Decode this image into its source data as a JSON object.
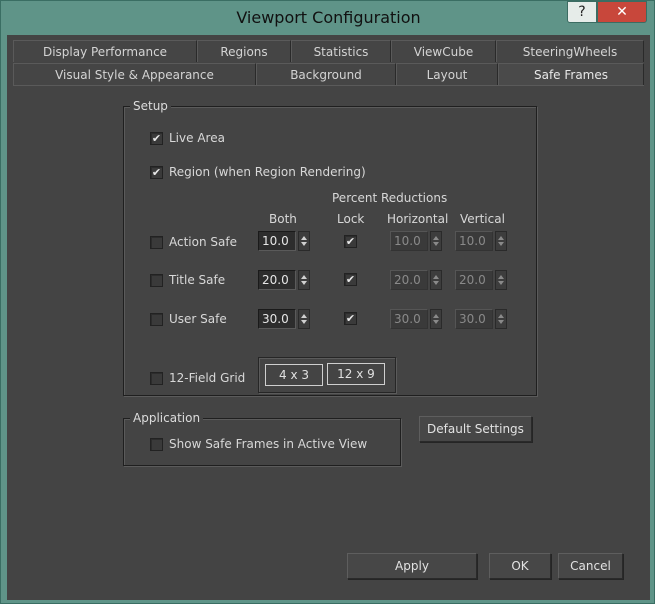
{
  "window": {
    "title": "Viewport Configuration",
    "help_glyph": "?",
    "close_glyph": "✕"
  },
  "tabs": {
    "row1": [
      "Display Performance",
      "Regions",
      "Statistics",
      "ViewCube",
      "SteeringWheels"
    ],
    "row2": [
      "Visual Style & Appearance",
      "Background",
      "Layout",
      "Safe Frames"
    ],
    "active": "Safe Frames"
  },
  "setup": {
    "legend": "Setup",
    "live_area": {
      "label": "Live Area",
      "checked": true
    },
    "region": {
      "label": "Region (when Region Rendering)",
      "checked": true
    },
    "percent_reductions_header": "Percent Reductions",
    "col_both": "Both",
    "col_lock": "Lock",
    "col_horizontal": "Horizontal",
    "col_vertical": "Vertical",
    "rows": [
      {
        "label": "Action Safe",
        "checked": false,
        "both": "10.0",
        "lock": true,
        "horizontal": "10.0",
        "vertical": "10.0"
      },
      {
        "label": "Title Safe",
        "checked": false,
        "both": "20.0",
        "lock": true,
        "horizontal": "20.0",
        "vertical": "20.0"
      },
      {
        "label": "User Safe",
        "checked": false,
        "both": "30.0",
        "lock": true,
        "horizontal": "30.0",
        "vertical": "30.0"
      }
    ],
    "field_grid": {
      "label": "12-Field Grid",
      "checked": false,
      "btn_4x3": "4 x 3",
      "btn_12x9": "12 x 9"
    }
  },
  "application": {
    "legend": "Application",
    "show_safe_frames": {
      "label": "Show Safe Frames in Active View",
      "checked": false
    }
  },
  "buttons": {
    "default_settings": "Default Settings",
    "apply": "Apply",
    "ok": "OK",
    "cancel": "Cancel"
  },
  "colors": {
    "panel_bg": "#444444",
    "frame": "#5f9488",
    "close": "#c8473b"
  }
}
